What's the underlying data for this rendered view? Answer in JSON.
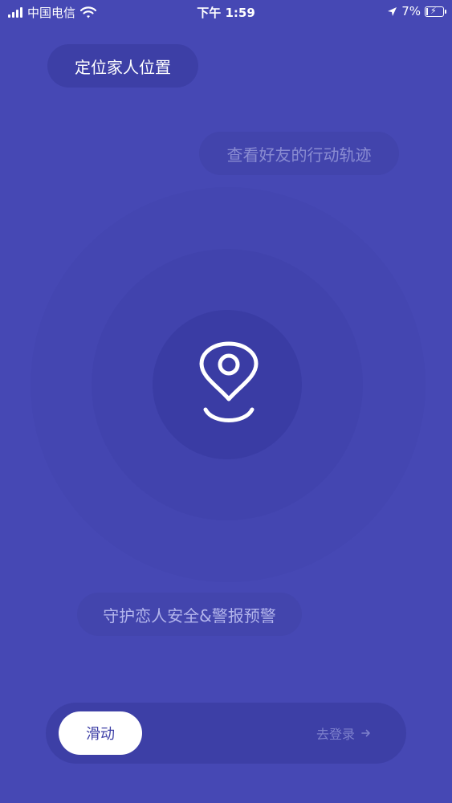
{
  "status_bar": {
    "carrier": "中国电信",
    "time": "下午 1:59",
    "battery": "7%"
  },
  "features": {
    "locate_family": "定位家人位置",
    "friend_tracks": "查看好友的行动轨迹",
    "guard_lover": "守护恋人安全&警报预警"
  },
  "slider": {
    "knob_label": "滑动",
    "hint": "去登录"
  }
}
